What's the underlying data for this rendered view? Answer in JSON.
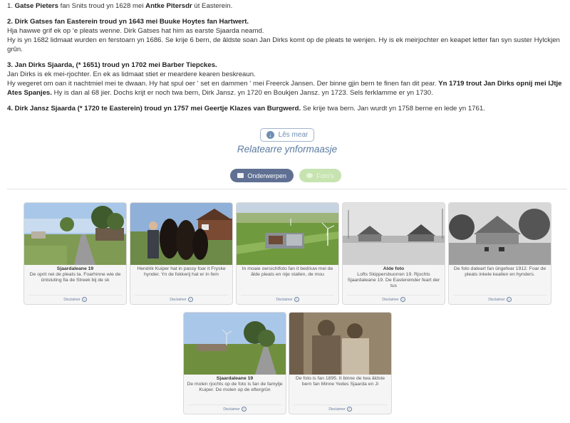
{
  "article": {
    "p1": {
      "name1": "Gatse Pieters",
      "mid": " fan Snits troud yn 1628 mei ",
      "name2": "Antke Pitersdr",
      "end": " út Easterein."
    },
    "p2": {
      "heading": "2. Dirk Gatses fan Easterein troud yn 1643 mei Buuke Hoytes fan Hartwert.",
      "line1": "Hja hawwe grif ek op ‘e pleats wenne. Dirk Gatses hat him as earste Sjaarda neamd.",
      "line2": "Hy is yn 1682 lidmaat wurden en ferstoarn yn 1686. Se krije 6 bern, de âldste soan Jan Dirks komt op de pleats te wenjen. Hy is ek meirjochter en keapet letter fan syn suster Hylckjen grûn."
    },
    "p3": {
      "heading": "3. Jan Dirks Sjaarda, (* 1651) troud yn 1702 mei Barber Tiepckes.",
      "line1": "Jan Dirks is ek mei-rjochter. En ek as lidmaat stiet er meardere kearen beskreaun.",
      "line2a": "Hy wegeret om oan it nachtmiel mei te dwaan. Hy hat spul oer ‘ set en dammen ‘ mei Freerck Jansen. Der binne gjin bern te finen fan dit pear. ",
      "line2b": "Yn 1719 trout Jan Dirks opnij mei IJtje Ates Spanjes.",
      "line2c": " Hy is dan al 68 jier. Dochs krijt er noch twa bern, Dirk Jansz. yn 1720 en Boukjen Jansz. yn 1723. Sels ferklamme er yn 1730."
    },
    "p4": {
      "heading": "4. Dirk Jansz Sjaarda (* 1720 te Easterein) troud yn 1757 mei Geertje Klazes van Burgwerd.",
      "rest": " Se krije twa bern. Jan wurdt yn 1758 berne en lede yn 1761."
    }
  },
  "more_button": "Lês mear",
  "section_title": "Relatearre ynformaasje",
  "tabs": {
    "topics": "Onderwerpen",
    "photos": "Foto's"
  },
  "disclaimer": "Disclaimer",
  "cards": [
    {
      "title": "Sjaardaleane 19",
      "caption": "De oprit nei de pleats ta. Foarhinne wie de ûntsluting fia de Streek bij de sk",
      "photo": "road-farm-trees"
    },
    {
      "title": "",
      "caption": "Hendrik Kuiper hat in passy foar it Fryske hynder. Yn de fokkerij hat er in fem",
      "photo": "man-with-horses"
    },
    {
      "title": "",
      "caption": "In moaie oersichtfoto fan it bedriuw mei de âlde pleats en nije stallen, de mou",
      "photo": "aerial-farm"
    },
    {
      "title": "Alde foto",
      "caption": "Lofts Skippersbuorren 19. Rjochts Sjaardaleane 19. De Eastereinder feart der tus",
      "photo": "old-canal-photo"
    },
    {
      "title": "",
      "caption": "De foto dateart fan ûngefear 1912. Foar de pleats inkele keallen en hynders.",
      "photo": "old-farm-1912"
    },
    {
      "title": "Sjaardaleane 19",
      "caption": "De molen rjochts op de foto is fan de famylje Kuiper. De molen op de eftergrûn",
      "photo": "farm-windmill"
    },
    {
      "title": "",
      "caption": "De foto is fan 1895. It binne de twa âldste bern fan Minne Yedes Sjaarda en Ji",
      "photo": "children-1895"
    }
  ]
}
